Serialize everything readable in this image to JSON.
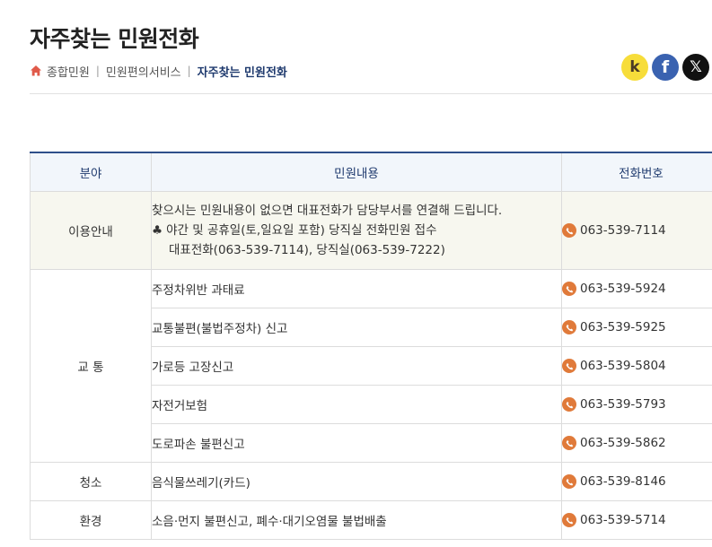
{
  "page": {
    "title": "자주찾는 민원전화"
  },
  "breadcrumb": {
    "items": [
      "종합민원",
      "민원편의서비스"
    ],
    "current": "자주찾는 민원전화",
    "separator": "|"
  },
  "share": {
    "kakao_label": "k",
    "facebook_label": "f",
    "x_label": "𝕏"
  },
  "table": {
    "headers": {
      "field": "분야",
      "content": "민원내용",
      "phone": "전화번호"
    },
    "guide": {
      "field": "이용안내",
      "line1": "찾으시는 민원내용이 없으면 대표전화가 담당부서를 연결해 드립니다.",
      "line2_symbol": "♣",
      "line2": "야간 및 공휴일(토,일요일 포함) 당직실 전화민원 접수",
      "line3": "대표전화(063-539-7114), 당직실(063-539-7222)",
      "phone": "063-539-7114"
    },
    "traffic": {
      "field": "교 통",
      "rows": [
        {
          "content": "주정차위반 과태료",
          "phone": "063-539-5924"
        },
        {
          "content": "교통불편(불법주정차) 신고",
          "phone": "063-539-5925"
        },
        {
          "content": "가로등 고장신고",
          "phone": "063-539-5804"
        },
        {
          "content": "자전거보험",
          "phone": "063-539-5793"
        },
        {
          "content": "도로파손 불편신고",
          "phone": "063-539-5862"
        }
      ]
    },
    "cleaning": {
      "field": "청소",
      "content": "음식물쓰레기(카드)",
      "phone": "063-539-8146"
    },
    "environment": {
      "field": "환경",
      "content": "소음·먼지 불편신고, 폐수·대기오염물 불법배출",
      "phone": "063-539-5714"
    }
  },
  "colors": {
    "accent": "#e07a3a",
    "header_text": "#1f3a6e",
    "highlight_row": "#f7f7ef"
  }
}
